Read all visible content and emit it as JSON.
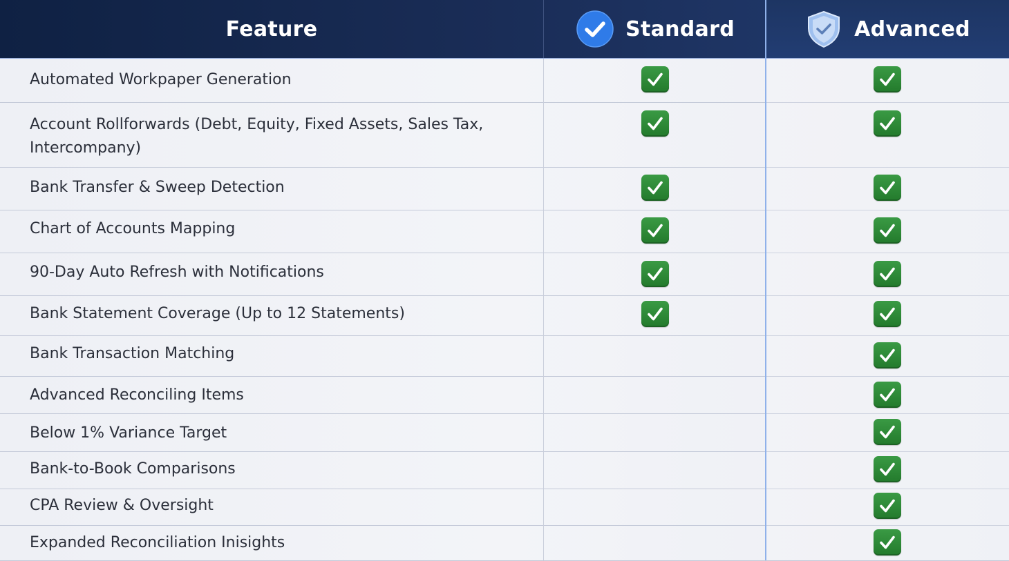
{
  "header": {
    "feature_label": "Feature",
    "standard_label": "Standard",
    "advanced_label": "Advanced",
    "standard_icon": "blue-check-circle-icon",
    "advanced_icon": "shield-check-icon"
  },
  "colors": {
    "header_bg": "#1a2d57",
    "check_green": "#2e8b37",
    "accent_blue": "#2f7be8"
  },
  "rows": [
    {
      "feature": "Automated Workpaper Generation",
      "standard": true,
      "advanced": true
    },
    {
      "feature": "Account Rollforwards (Debt, Equity, Fixed Assets, Sales Tax, Intercompany)",
      "standard": true,
      "advanced": true
    },
    {
      "feature": "Bank Transfer & Sweep Detection",
      "standard": true,
      "advanced": true
    },
    {
      "feature": "Chart of Accounts Mapping",
      "standard": true,
      "advanced": true
    },
    {
      "feature": "90-Day Auto Refresh with Notifications",
      "standard": true,
      "advanced": true
    },
    {
      "feature": "Bank Statement Coverage (Up to 12 Statements)",
      "standard": true,
      "advanced": true
    },
    {
      "feature": "Bank Transaction Matching",
      "standard": false,
      "advanced": true
    },
    {
      "feature": "Advanced Reconciling Items",
      "standard": false,
      "advanced": true
    },
    {
      "feature": "Below 1% Variance Target",
      "standard": false,
      "advanced": true
    },
    {
      "feature": "Bank-to-Book Comparisons",
      "standard": false,
      "advanced": true
    },
    {
      "feature": "CPA Review & Oversight",
      "standard": false,
      "advanced": true
    },
    {
      "feature": "Expanded Reconciliation Inisights",
      "standard": false,
      "advanced": true
    }
  ]
}
